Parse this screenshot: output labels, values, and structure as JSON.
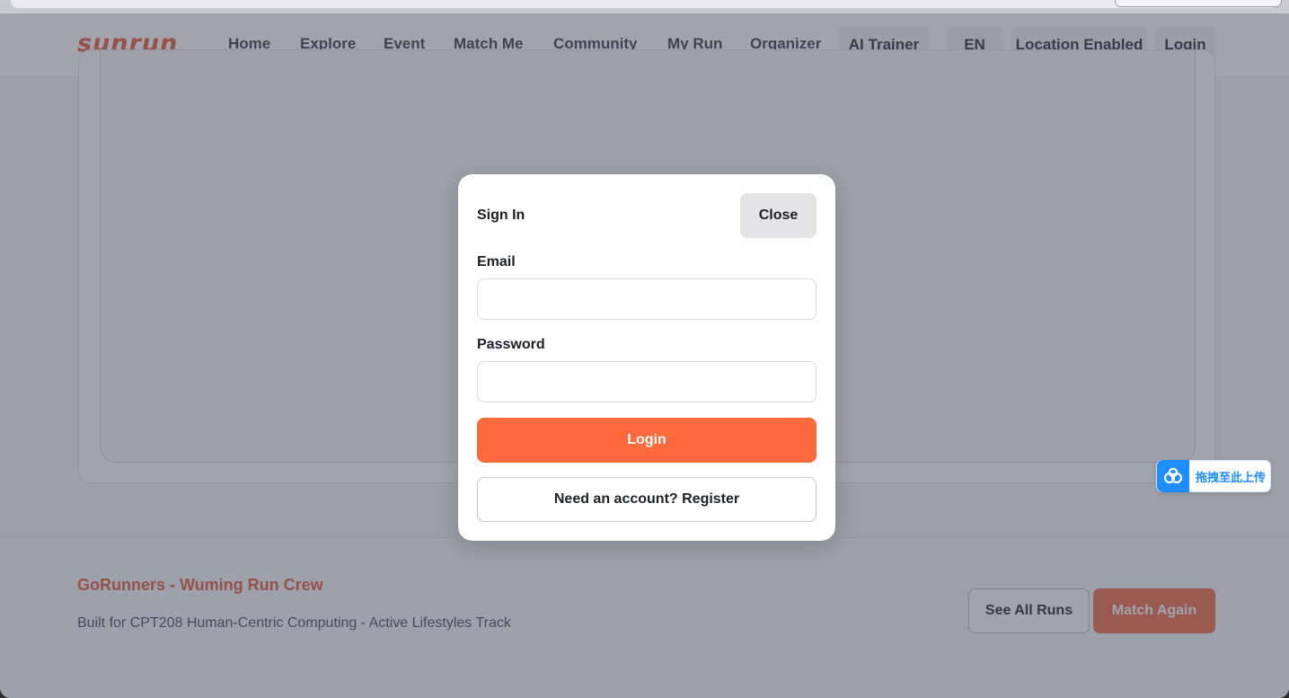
{
  "brand": {
    "logo": "sunrun"
  },
  "nav": {
    "links": [
      {
        "label": "Home"
      },
      {
        "label": "Explore"
      },
      {
        "label": "Event"
      },
      {
        "label": "Match Me"
      },
      {
        "label": "Community"
      },
      {
        "label": "My Run"
      },
      {
        "label": "Organizer"
      },
      {
        "label": "AI Trainer"
      }
    ],
    "language": "EN",
    "location": "Location Enabled",
    "login": "Login"
  },
  "footer": {
    "title": "GoRunners - Wuming Run Crew",
    "subtitle": "Built for CPT208 Human-Centric Computing - Active Lifestyles Track",
    "see_all_runs": "See All Runs",
    "match_again": "Match Again"
  },
  "modal": {
    "title": "Sign In",
    "close_label": "Close",
    "email_label": "Email",
    "email_value": "",
    "password_label": "Password",
    "password_value": "",
    "login_label": "Login",
    "register_label": "Need an account? Register"
  },
  "upload_widget": {
    "label": "拖拽至此上传",
    "icon": "cloud-upload-icon"
  },
  "colors": {
    "brand": "#e25a36",
    "primary_button": "#ff6a3d",
    "overlay": "#464a5c",
    "upload_accent": "#1f8cff"
  }
}
